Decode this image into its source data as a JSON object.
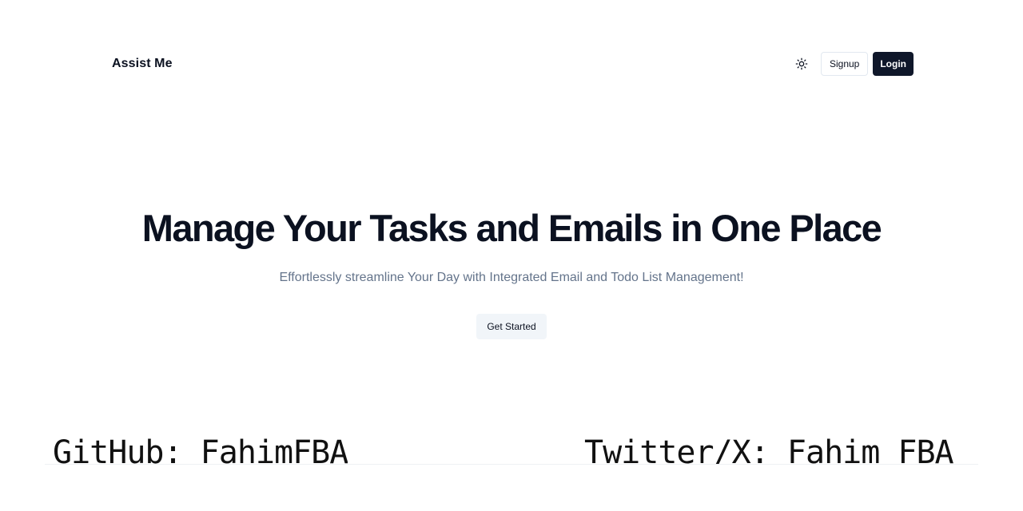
{
  "header": {
    "brand": "Assist Me",
    "theme_toggle_icon": "sun-icon",
    "signup_label": "Signup",
    "login_label": "Login"
  },
  "hero": {
    "title": "Manage Your Tasks and Emails in One Place",
    "subtitle": "Effortlessly streamline Your Day with Integrated Email and Todo List Management!",
    "cta_label": "Get Started"
  },
  "footer": {
    "github": "GitHub: FahimFBA",
    "twitter": "Twitter/X: Fahim_FBA"
  },
  "colors": {
    "primary_dark": "#0f172a",
    "text": "#0b1120",
    "muted_text": "#64748b",
    "secondary_bg": "#f1f5f9",
    "border": "#e2e8f0"
  }
}
